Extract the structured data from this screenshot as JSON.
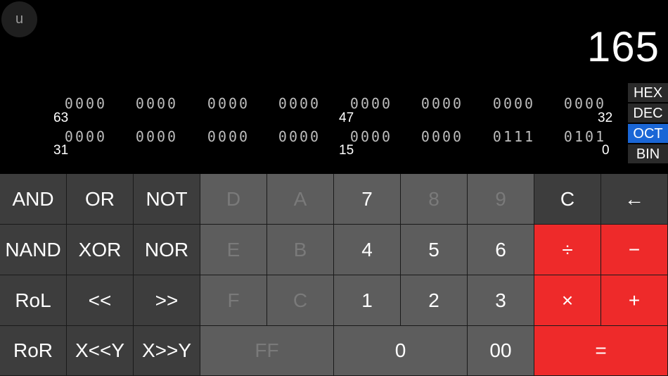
{
  "user_button": "u",
  "display_value": "165",
  "bit_rows": [
    {
      "nibbles": [
        "0000",
        "0000",
        "0000",
        "0000",
        "0000",
        "0000",
        "0000",
        "0000"
      ],
      "labels": [
        "63",
        "47",
        "32"
      ]
    },
    {
      "nibbles": [
        "0000",
        "0000",
        "0000",
        "0000",
        "0000",
        "0000",
        "0111",
        "0101"
      ],
      "labels": [
        "31",
        "15",
        "0"
      ]
    }
  ],
  "modes": [
    "HEX",
    "DEC",
    "OCT",
    "BIN"
  ],
  "active_mode": "OCT",
  "keys": [
    [
      "AND",
      "OR",
      "NOT",
      "D",
      "A",
      "7",
      "8",
      "9",
      "C",
      "←"
    ],
    [
      "NAND",
      "XOR",
      "NOR",
      "E",
      "B",
      "4",
      "5",
      "6",
      "÷",
      "−"
    ],
    [
      "RoL",
      "<<",
      ">>",
      "F",
      "C",
      "1",
      "2",
      "3",
      "×",
      "+"
    ],
    [
      "RoR",
      "X<<Y",
      "X>>Y",
      "FF",
      "0",
      "00",
      "="
    ]
  ],
  "colors": {
    "active_mode": "#1a66d6",
    "operator": "#ee2a2a"
  }
}
